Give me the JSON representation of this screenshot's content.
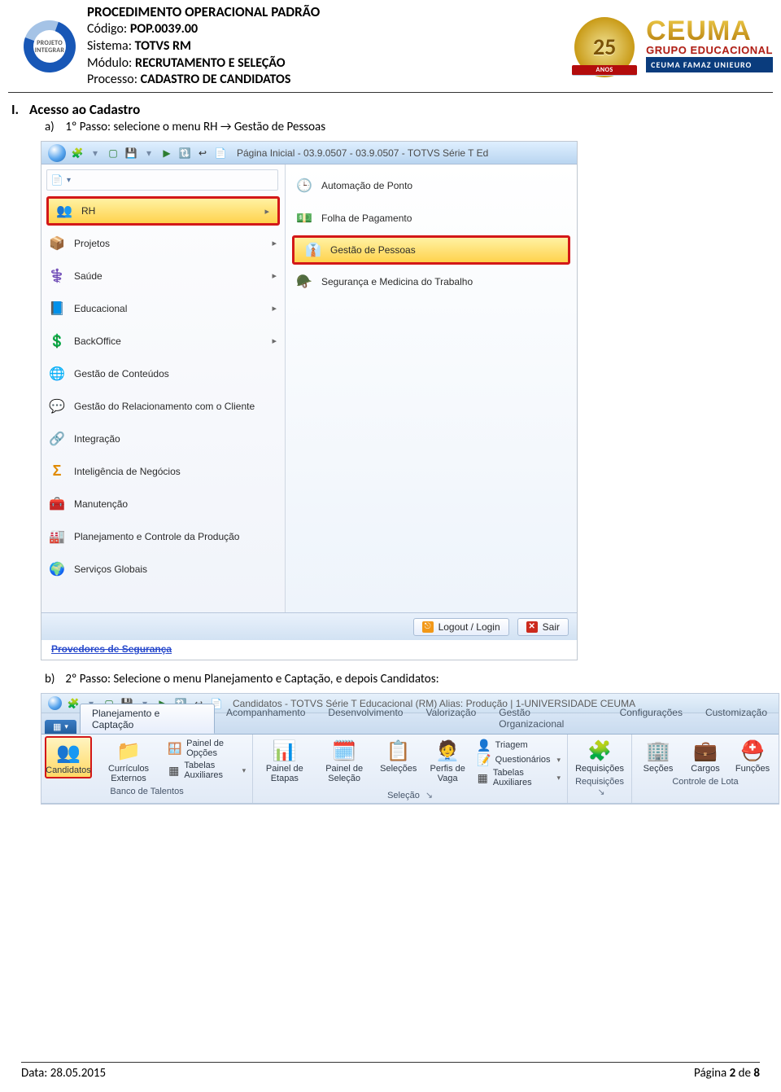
{
  "header": {
    "title": "PROCEDIMENTO OPERACIONAL PADRÃO",
    "codigo_label": "Código:",
    "codigo_value": "POP.0039.00",
    "sistema_label": "Sistema:",
    "sistema_value": "TOTVS RM",
    "modulo_label": "Módulo:",
    "modulo_value": "RECRUTAMENTO E SELEÇÃO",
    "processo_label": "Processo:",
    "processo_value": "CADASTRO DE CANDIDATOS",
    "integrar_line1": "PROJETO",
    "integrar_line2": "INTEGRAR",
    "badge_num": "25",
    "badge_ribbon": "ANOS",
    "ceuma_top": "CEUMA",
    "ceuma_sub": "GRUPO EDUCACIONAL",
    "ceuma_bar": "CEUMA FAMAZ UNIEURO"
  },
  "section": {
    "num": "I.",
    "title": "Acesso ao Cadastro",
    "a_label": "a)",
    "a_text": "1º Passo: selecione o menu RH → Gestão de Pessoas",
    "b_label": "b)",
    "b_text": "2º Passo: Selecione o menu  Planejamento e Captação, e depois Candidatos:"
  },
  "shot1": {
    "titlebar": "Página Inicial - 03.9.0507 - 03.9.0507 - TOTVS Série T Ed",
    "left_menu": [
      {
        "label": "RH",
        "arrow": true,
        "highlight": true,
        "icon": "i-rh"
      },
      {
        "label": "Projetos",
        "arrow": true,
        "highlight": false,
        "icon": "i-proj"
      },
      {
        "label": "Saúde",
        "arrow": true,
        "highlight": false,
        "icon": "i-saude"
      },
      {
        "label": "Educacional",
        "arrow": true,
        "highlight": false,
        "icon": "i-edu"
      },
      {
        "label": "BackOffice",
        "arrow": true,
        "highlight": false,
        "icon": "i-back"
      },
      {
        "label": "Gestão de Conteúdos",
        "arrow": false,
        "highlight": false,
        "icon": "i-cont"
      },
      {
        "label": "Gestão do Relacionamento com o Cliente",
        "arrow": false,
        "highlight": false,
        "icon": "i-rel"
      },
      {
        "label": "Integração",
        "arrow": false,
        "highlight": false,
        "icon": "i-int"
      },
      {
        "label": "Inteligência de Negócios",
        "arrow": false,
        "highlight": false,
        "icon": "i-bi"
      },
      {
        "label": "Manutenção",
        "arrow": false,
        "highlight": false,
        "icon": "i-manu"
      },
      {
        "label": "Planejamento e Controle da Produção",
        "arrow": false,
        "highlight": false,
        "icon": "i-pcp"
      },
      {
        "label": "Serviços Globais",
        "arrow": false,
        "highlight": false,
        "icon": "i-glob"
      }
    ],
    "right_menu": [
      {
        "label": "Automação de Ponto",
        "highlight": false,
        "icon": "i-clock"
      },
      {
        "label": "Folha de Pagamento",
        "highlight": false,
        "icon": "i-pay"
      },
      {
        "label": "Gestão de Pessoas",
        "highlight": true,
        "icon": "i-gest"
      },
      {
        "label": "Segurança e Medicina do Trabalho",
        "highlight": false,
        "icon": "i-seg"
      }
    ],
    "logout_btn": "Logout / Login",
    "sair_btn": "Sair",
    "below_link": "Provedores de Segurança"
  },
  "shot2": {
    "titlebar": "Candidatos - TOTVS Série T Educacional (RM) Alias: Produção | 1-UNIVERSIDADE CEUMA",
    "pill_label": "",
    "tabs": [
      {
        "label": "Planejamento e Captação",
        "active": true
      },
      {
        "label": "Acompanhamento",
        "active": false
      },
      {
        "label": "Desenvolvimento",
        "active": false
      },
      {
        "label": "Valorização",
        "active": false
      },
      {
        "label": "Gestão Organizacional",
        "active": false
      },
      {
        "label": "Configurações",
        "active": false
      },
      {
        "label": "Customização",
        "active": false
      }
    ],
    "groups": {
      "banco": {
        "candidatos": "Candidatos",
        "curriculos": "Currículos\nExternos",
        "painel_opcoes": "Painel de Opções",
        "tabelas_aux": "Tabelas Auxiliares",
        "caption": "Banco de Talentos"
      },
      "selecao": {
        "painel_etapas": "Painel de\nEtapas",
        "painel_selecao": "Painel de\nSeleção",
        "selecoes": "Seleções",
        "perfis": "Perfis\nde Vaga",
        "triagem": "Triagem",
        "questionarios": "Questionários",
        "tabelas_aux": "Tabelas Auxiliares",
        "caption": "Seleção"
      },
      "requisicoes": {
        "requisicoes": "Requisições",
        "caption": "Requisições"
      },
      "lota": {
        "secoes": "Seções",
        "cargos": "Cargos",
        "funcoes": "Funções",
        "caption": "Controle de Lota"
      }
    }
  },
  "footer": {
    "data_label": "Data:",
    "data_value": "28.05.2015",
    "pagina_label": "Página",
    "pagina_num": "2",
    "pagina_de": "de",
    "pagina_total": "8"
  }
}
